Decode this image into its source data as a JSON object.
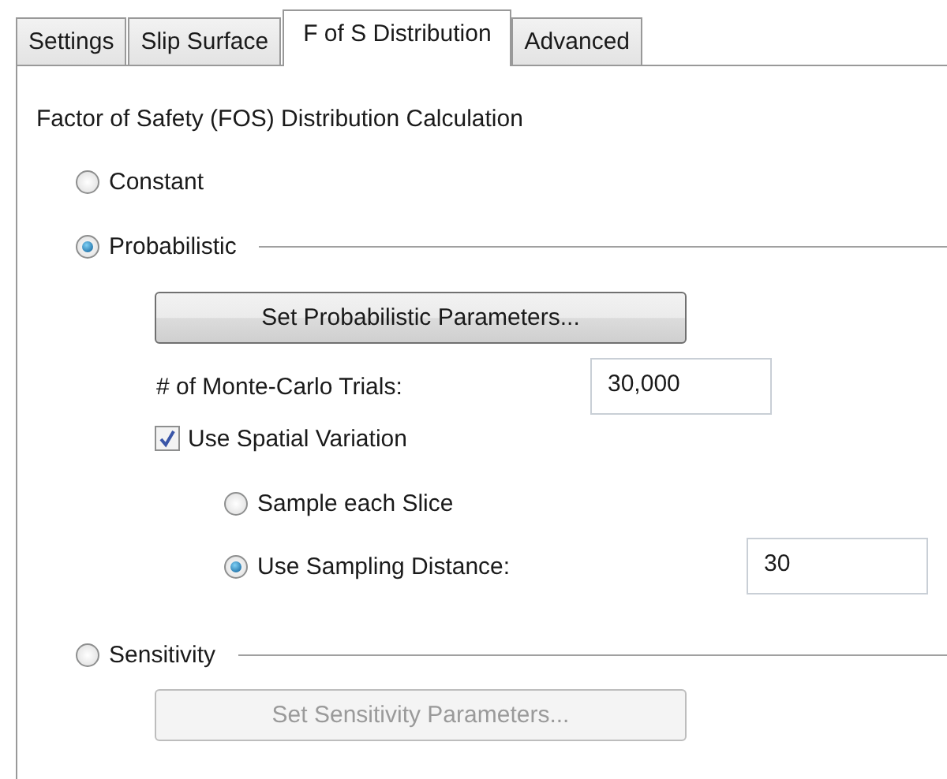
{
  "tabs": [
    {
      "label": "Settings",
      "selected": false
    },
    {
      "label": "Slip Surface",
      "selected": false
    },
    {
      "label": "F of S Distribution",
      "selected": true
    },
    {
      "label": "Advanced",
      "selected": false
    }
  ],
  "heading": "Factor of Safety (FOS) Distribution Calculation",
  "options": [
    {
      "label": "Constant",
      "selected": false
    },
    {
      "label": "Probabilistic",
      "selected": true,
      "button": {
        "label": "Set Probabilistic Parameters...",
        "disabled": false
      },
      "trials": {
        "label": "# of Monte-Carlo Trials:",
        "value": "30,000"
      },
      "spatial": {
        "label": "Use Spatial Variation",
        "checked": true
      },
      "sampling": [
        {
          "label": "Sample each Slice",
          "selected": false
        },
        {
          "label": "Use Sampling Distance:",
          "selected": true,
          "value": "30"
        }
      ]
    },
    {
      "label": "Sensitivity",
      "selected": false,
      "button": {
        "label": "Set Sensitivity Parameters...",
        "disabled": true
      }
    }
  ]
}
